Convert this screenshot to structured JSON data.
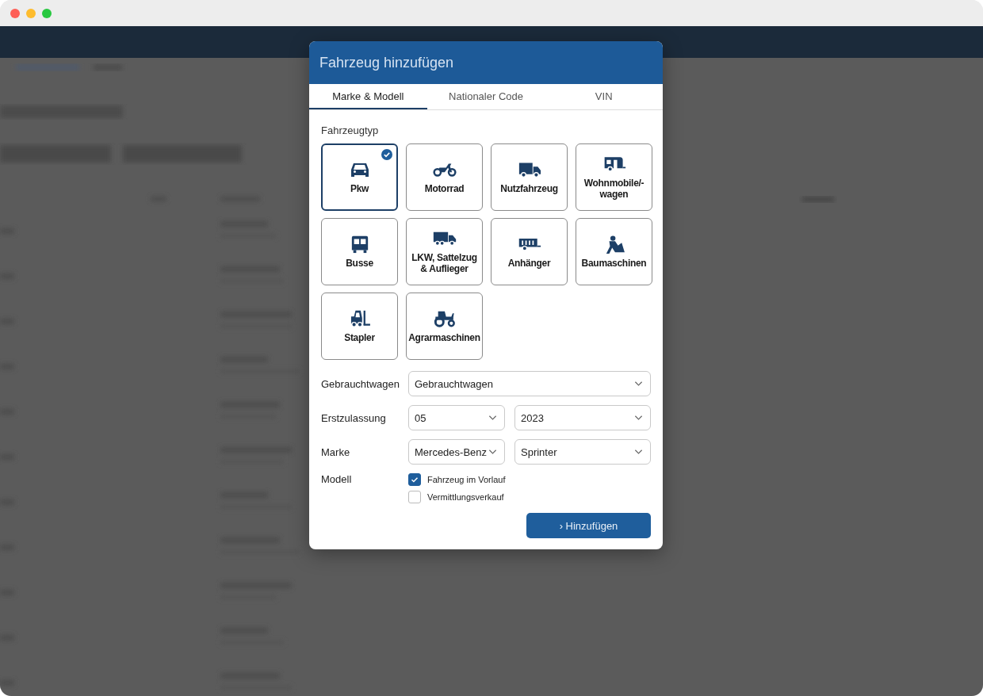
{
  "dialog": {
    "title": "Fahrzeug hinzufügen",
    "tabs": [
      {
        "label": "Marke & Modell",
        "selected": true
      },
      {
        "label": "Nationaler Code",
        "selected": false
      },
      {
        "label": "VIN",
        "selected": false
      }
    ],
    "section_label": "Fahrzeugtyp",
    "vehicle_types": [
      {
        "label": "Pkw",
        "selected": true
      },
      {
        "label": "Motorrad",
        "selected": false
      },
      {
        "label": "Nutzfahrzeug",
        "selected": false
      },
      {
        "label": "Wohnmobile/-\nwagen",
        "selected": false
      },
      {
        "label": "Busse",
        "selected": false
      },
      {
        "label": "LKW, Sattelzug\n& Auflieger",
        "selected": false
      },
      {
        "label": "Anhänger",
        "selected": false
      },
      {
        "label": "Baumaschinen",
        "selected": false
      },
      {
        "label": "Stapler",
        "selected": false
      },
      {
        "label": "Agrarmaschinen",
        "selected": false
      }
    ],
    "form_rows": [
      {
        "label": "Gebrauchtwagen",
        "selects": [
          "Gebrauchtwagen"
        ]
      },
      {
        "label": "Erstzulassung",
        "selects": [
          "05",
          "2023"
        ]
      },
      {
        "label": "Marke",
        "selects": [
          "Mercedes-Benz",
          "Sprinter"
        ]
      }
    ],
    "model": {
      "label": "Modell",
      "options": [
        {
          "label": "Fahrzeug im Vorlauf",
          "checked": true
        },
        {
          "label": "Vermittlungsverkauf",
          "checked": false
        }
      ]
    },
    "submit_button": {
      "icon": "›",
      "label": "Hinzufügen"
    }
  }
}
